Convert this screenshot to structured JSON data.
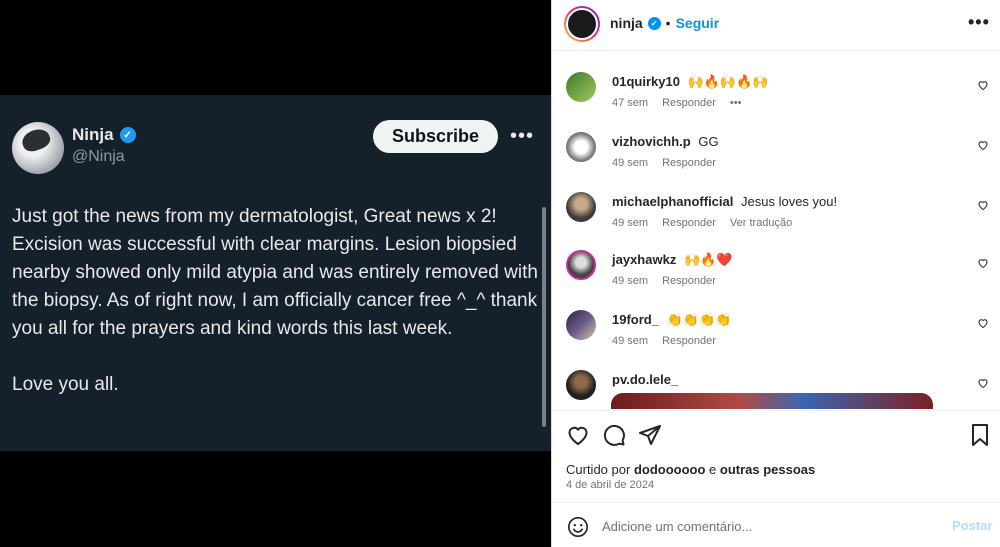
{
  "tweet": {
    "name": "Ninja",
    "handle": "@Ninja",
    "subscribe_label": "Subscribe",
    "more_icon": "•••",
    "body_p1": "Just got the news from my dermatologist, Great news x 2! Excision was successful with clear margins.  Lesion biopsied nearby showed only mild atypia and was entirely removed with the biopsy. As of right now, I am officially cancer free ^_^ thank you all for the prayers and kind words this last week.",
    "body_p2": "Love you all."
  },
  "header": {
    "username": "ninja",
    "separator": "•",
    "follow_label": "Seguir",
    "more_icon": "•••"
  },
  "comments": [
    {
      "user": "01quirky10",
      "text": "🙌🔥🙌🔥🙌",
      "time": "47 sem",
      "reply": "Responder",
      "extra": "•••"
    },
    {
      "user": "vizhovichh.p",
      "text": "GG",
      "time": "49 sem",
      "reply": "Responder",
      "extra": ""
    },
    {
      "user": "michaelphanofficial",
      "text": "Jesus loves you!",
      "time": "49 sem",
      "reply": "Responder",
      "extra": "Ver tradução"
    },
    {
      "user": "jayxhawkz",
      "text": "🙌🔥❤️",
      "time": "49 sem",
      "reply": "Responder",
      "extra": ""
    },
    {
      "user": "19ford_",
      "text": "👏👏👏👏",
      "time": "49 sem",
      "reply": "Responder",
      "extra": ""
    },
    {
      "user": "pv.do.lele_",
      "text": "",
      "time": "",
      "reply": "",
      "extra": ""
    }
  ],
  "footer": {
    "liked_prefix": "Curtido por",
    "liked_user": "dodoooooo",
    "liked_and": "e",
    "liked_others": "outras pessoas",
    "date": "4 de abril de 2024",
    "comment_placeholder": "Adicione um comentário...",
    "post_label": "Postar"
  },
  "colors": {
    "tweet_bg": "#15202b",
    "instagram_blue": "#0095f6",
    "verified_blue": "#1d9bf0"
  }
}
